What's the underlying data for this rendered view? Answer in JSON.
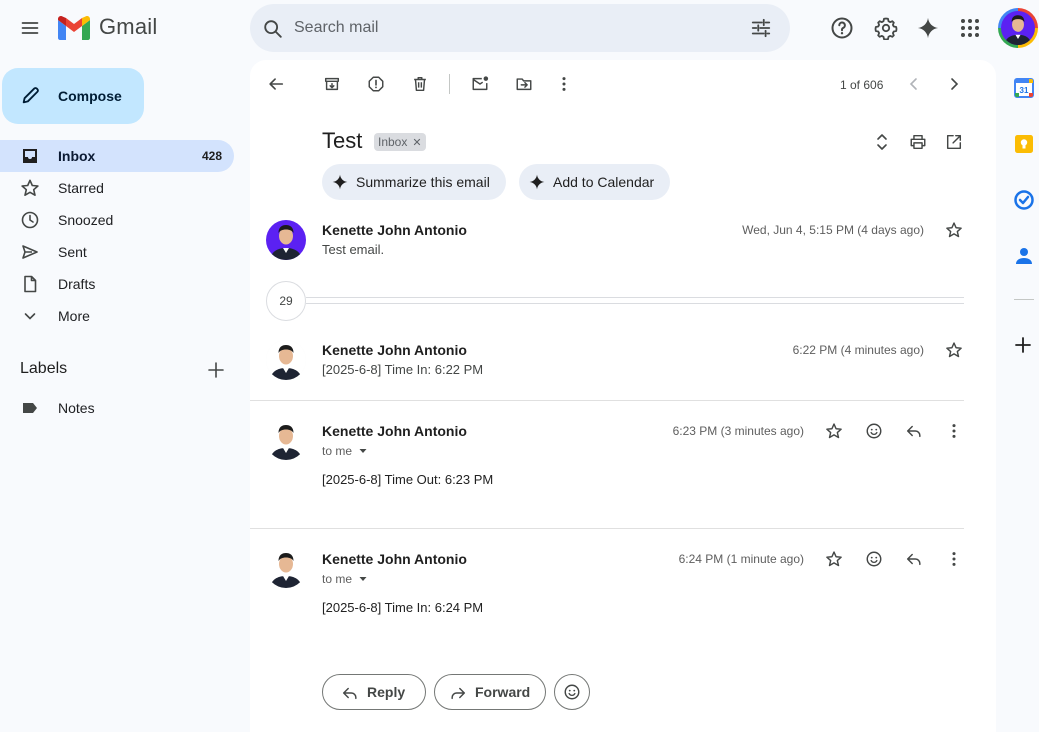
{
  "header": {
    "brand": "Gmail",
    "search_placeholder": "Search mail"
  },
  "sidebar": {
    "compose_label": "Compose",
    "items": [
      {
        "label": "Inbox",
        "count": "428",
        "icon": "inbox-icon",
        "active": true
      },
      {
        "label": "Starred",
        "icon": "star-icon"
      },
      {
        "label": "Snoozed",
        "icon": "clock-icon"
      },
      {
        "label": "Sent",
        "icon": "send-icon"
      },
      {
        "label": "Drafts",
        "icon": "draft-icon"
      },
      {
        "label": "More",
        "icon": "chevron-down-icon"
      }
    ],
    "labels_title": "Labels",
    "labels": [
      {
        "label": "Notes",
        "icon": "label-icon"
      }
    ]
  },
  "toolbar": {
    "pager": "1 of 606"
  },
  "thread": {
    "subject": "Test",
    "label_chip": "Inbox",
    "gemini_actions": [
      "Summarize this email",
      "Add to Calendar"
    ],
    "collapsed_count": "29",
    "messages": [
      {
        "sender": "Kenette John Antonio",
        "time": "Wed, Jun 4, 5:15 PM (4 days ago)",
        "snippet": "Test email."
      },
      {
        "sender": "Kenette John Antonio",
        "time": "6:22 PM (4 minutes ago)",
        "snippet": "[2025-6-8] Time In: 6:22 PM"
      },
      {
        "sender": "Kenette John Antonio",
        "time": "6:23 PM (3 minutes ago)",
        "to": "to me",
        "body": "[2025-6-8] Time Out: 6:23 PM"
      },
      {
        "sender": "Kenette John Antonio",
        "time": "6:24 PM (1 minute ago)",
        "to": "to me",
        "body": "[2025-6-8] Time In: 6:24 PM"
      }
    ],
    "reply_label": "Reply",
    "forward_label": "Forward"
  },
  "colors": {
    "accent": "#c2e7ff",
    "active_nav": "#d3e3fd",
    "search_bg": "#e9eef6",
    "avatar_purple": "#5b21f2"
  },
  "right_rail": {
    "icons": [
      "calendar-icon",
      "keep-icon",
      "tasks-icon",
      "contacts-icon",
      "add-addon-icon"
    ],
    "calendar_day": "31"
  }
}
